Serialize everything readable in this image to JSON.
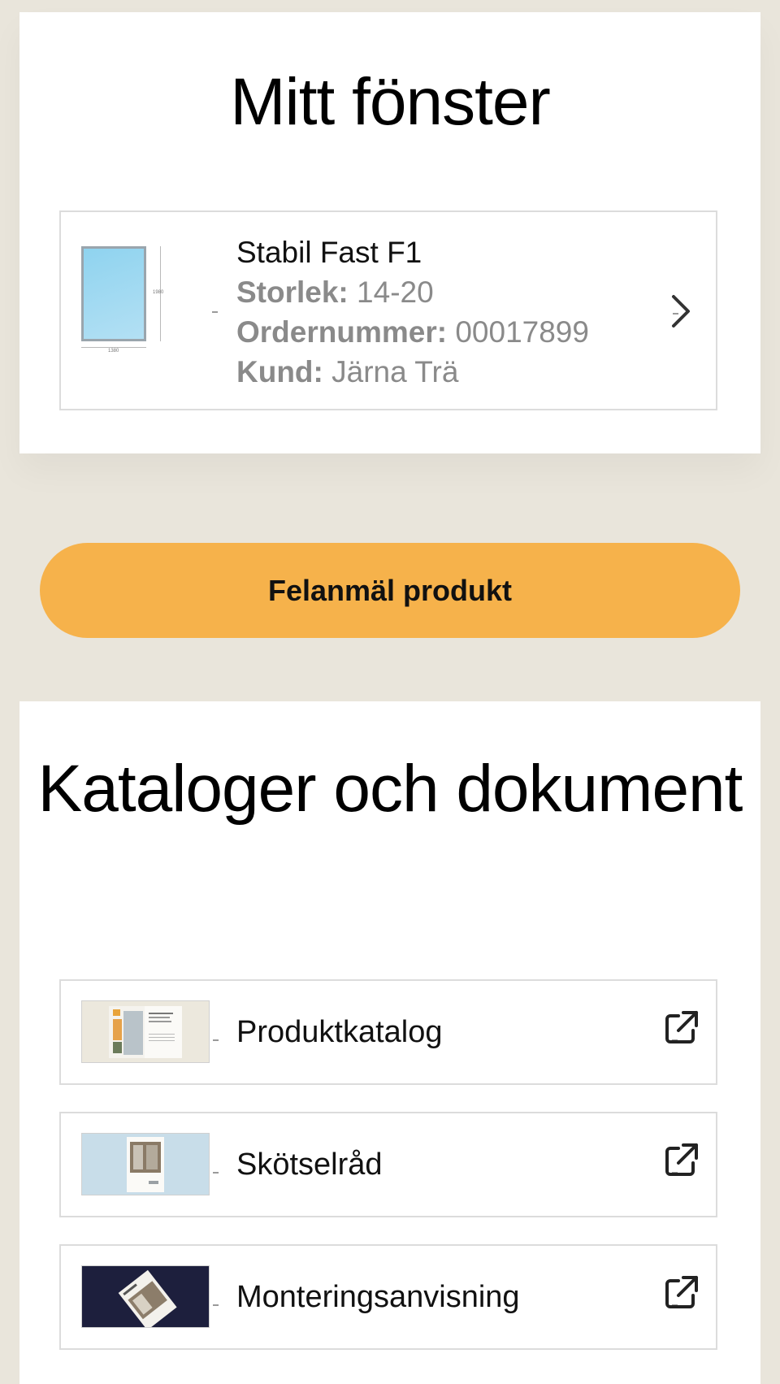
{
  "window_section": {
    "title": "Mitt fönster",
    "product": {
      "name": "Stabil Fast F1",
      "size_label": "Storlek:",
      "size_value": "14-20",
      "order_label": "Ordernummer:",
      "order_value": "00017899",
      "customer_label": "Kund:",
      "customer_value": "Järna Trä",
      "drawing_height": "1980",
      "drawing_width": "1380"
    }
  },
  "report_button": {
    "label": "Felanmäl produkt",
    "color": "#f6b24b"
  },
  "docs_section": {
    "title": "Kataloger och dokument",
    "items": [
      {
        "label": "Produktkatalog",
        "icon": "external-link-icon"
      },
      {
        "label": "Skötselråd",
        "icon": "external-link-icon"
      },
      {
        "label": "Monteringsanvisning",
        "icon": "external-link-icon"
      }
    ]
  },
  "colors": {
    "background": "#e9e5db",
    "card": "#ffffff",
    "border": "#dcdcdc",
    "muted_text": "#8a8a8a",
    "accent": "#f6b24b"
  }
}
